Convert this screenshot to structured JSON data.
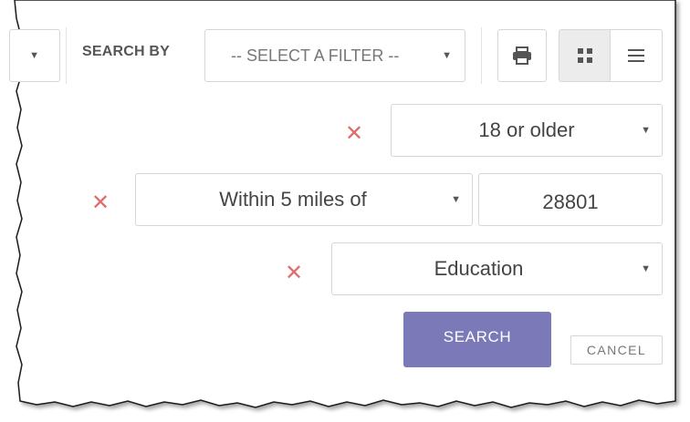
{
  "toolbar": {
    "left_select_caret": "▼",
    "search_by_label": "SEARCH BY",
    "filter_select": {
      "value": "-- SELECT A FILTER --",
      "caret": "▼"
    },
    "print_icon": "print-icon",
    "grid_view_icon": "grid-view-icon",
    "list_view_icon": "list-view-icon"
  },
  "filters": [
    {
      "remove_label": "✕",
      "select_value": "18 or older",
      "caret": "▼"
    },
    {
      "remove_label": "✕",
      "select_value": "Within 5 miles of",
      "caret": "▼",
      "input_value": "28801"
    },
    {
      "remove_label": "✕",
      "select_value": "Education",
      "caret": "▼"
    }
  ],
  "actions": {
    "search_label": "SEARCH",
    "cancel_label": "CANCEL"
  },
  "colors": {
    "accent": "#7b79b7",
    "remove": "#e26b6b",
    "border": "#d6d6d6",
    "text": "#555555",
    "active_view_bg": "#ececec"
  }
}
